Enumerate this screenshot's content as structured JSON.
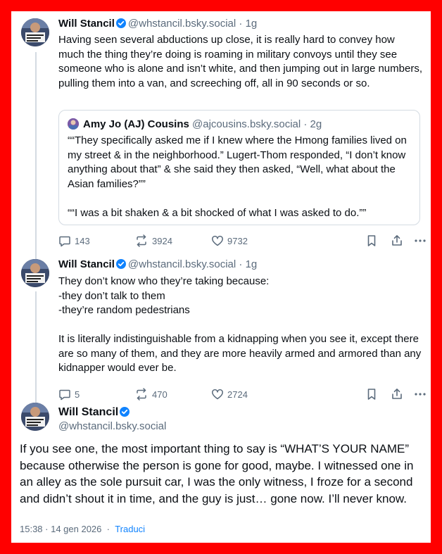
{
  "colors": {
    "frame": "#ff0000",
    "accent": "#1083fe",
    "muted": "#5b6b7c",
    "verified": "#1083fe"
  },
  "post1": {
    "author_name": "Will Stancil",
    "author_handle": "@whstancil.bsky.social",
    "time": "· 1g",
    "text": "Having seen several abductions up close, it is really hard to convey how much the thing they’re doing is roaming in military convoys until they see someone who is alone and isn’t white, and then jumping out in large numbers, pulling them into a van, and screeching off, all in 90 seconds or so.",
    "quote": {
      "author_name": "Amy Jo (AJ) Cousins",
      "author_handle": "@ajcousins.bsky.social",
      "time": "· 2g",
      "text": "““They specifically asked me if I knew where the Hmong families lived on my street & in the neighborhood.” Lugert-Thom responded, “I don’t know anything about that” & she said they then asked, “Well, what about the Asian families?””\n\n““I was a bit shaken & a bit shocked of what I was asked to do.””"
    },
    "replies": "143",
    "reposts": "3924",
    "likes": "9732"
  },
  "post2": {
    "author_name": "Will Stancil",
    "author_handle": "@whstancil.bsky.social",
    "time": "· 1g",
    "text": "They don’t know who they’re taking because:\n-they don’t talk to them\n-they’re random pedestrians\n\nIt is literally indistinguishable from a kidnapping when you see it, except there are so many of them, and they are more heavily armed and armored than any kidnapper would ever be.",
    "replies": "5",
    "reposts": "470",
    "likes": "2724"
  },
  "post3": {
    "author_name": "Will Stancil",
    "author_handle": "@whstancil.bsky.social",
    "text": "If you see one, the most important thing to say is “WHAT’S YOUR NAME” because otherwise the person is gone for good, maybe. I witnessed one in an alley as the sole pursuit car, I was the only witness, I froze for a second and didn’t shout it in time, and the guy is just… gone now. I’ll never know.",
    "timestamp": "15:38 · 14 gen 2026",
    "separator": "·",
    "translate_label": "Traduci"
  },
  "icons": {
    "reply": "reply-icon",
    "repost": "repost-icon",
    "like": "heart-icon",
    "bookmark": "bookmark-icon",
    "share": "share-icon",
    "more": "more-options-icon",
    "verified": "verified-badge-icon"
  }
}
